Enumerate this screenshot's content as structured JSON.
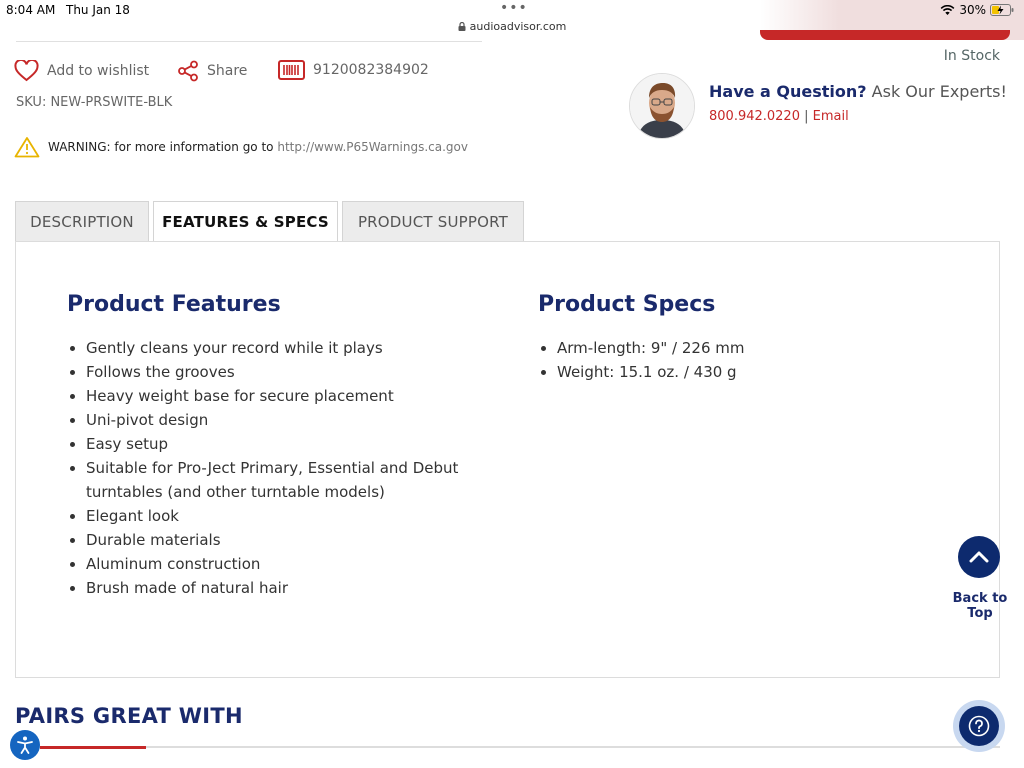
{
  "status_bar": {
    "time": "8:04 AM",
    "date": "Thu Jan 18",
    "url": "audioadvisor.com",
    "battery": "30%"
  },
  "actions": {
    "wishlist": "Add to wishlist",
    "share": "Share",
    "barcode": "9120082384902"
  },
  "sku": "SKU: NEW-PRSWITE-BLK",
  "warning": {
    "text": "WARNING: for more information go to",
    "link": "http://www.P65Warnings.ca.gov"
  },
  "stock": "In Stock",
  "expert": {
    "question_strong": "Have a Question?",
    "question_rest": "Ask Our Experts!",
    "phone": "800.942.0220",
    "separator": "|",
    "email": "Email"
  },
  "tabs": [
    {
      "label": "DESCRIPTION",
      "active": false
    },
    {
      "label": "FEATURES & SPECS",
      "active": true
    },
    {
      "label": "PRODUCT SUPPORT",
      "active": false
    }
  ],
  "features": {
    "title": "Product Features",
    "items": [
      "Gently cleans your record while it plays",
      "Follows the grooves",
      "Heavy weight base for secure placement",
      "Uni-pivot design",
      "Easy setup",
      "Suitable for Pro-Ject Primary, Essential and Debut turntables (and other turntable models)",
      "Elegant look",
      "Durable materials",
      "Aluminum construction",
      "Brush made of natural hair"
    ]
  },
  "specs": {
    "title": "Product Specs",
    "items": [
      "Arm-length: 9\" / 226 mm",
      "Weight: 15.1 oz. / 430 g"
    ]
  },
  "back_to_top": {
    "line1": "Back to",
    "line2": "Top"
  },
  "pairs_heading": "PAIRS GREAT WITH",
  "colors": {
    "navy": "#1a2a6c",
    "red": "#c62828",
    "tab_inactive": "#ececec"
  }
}
